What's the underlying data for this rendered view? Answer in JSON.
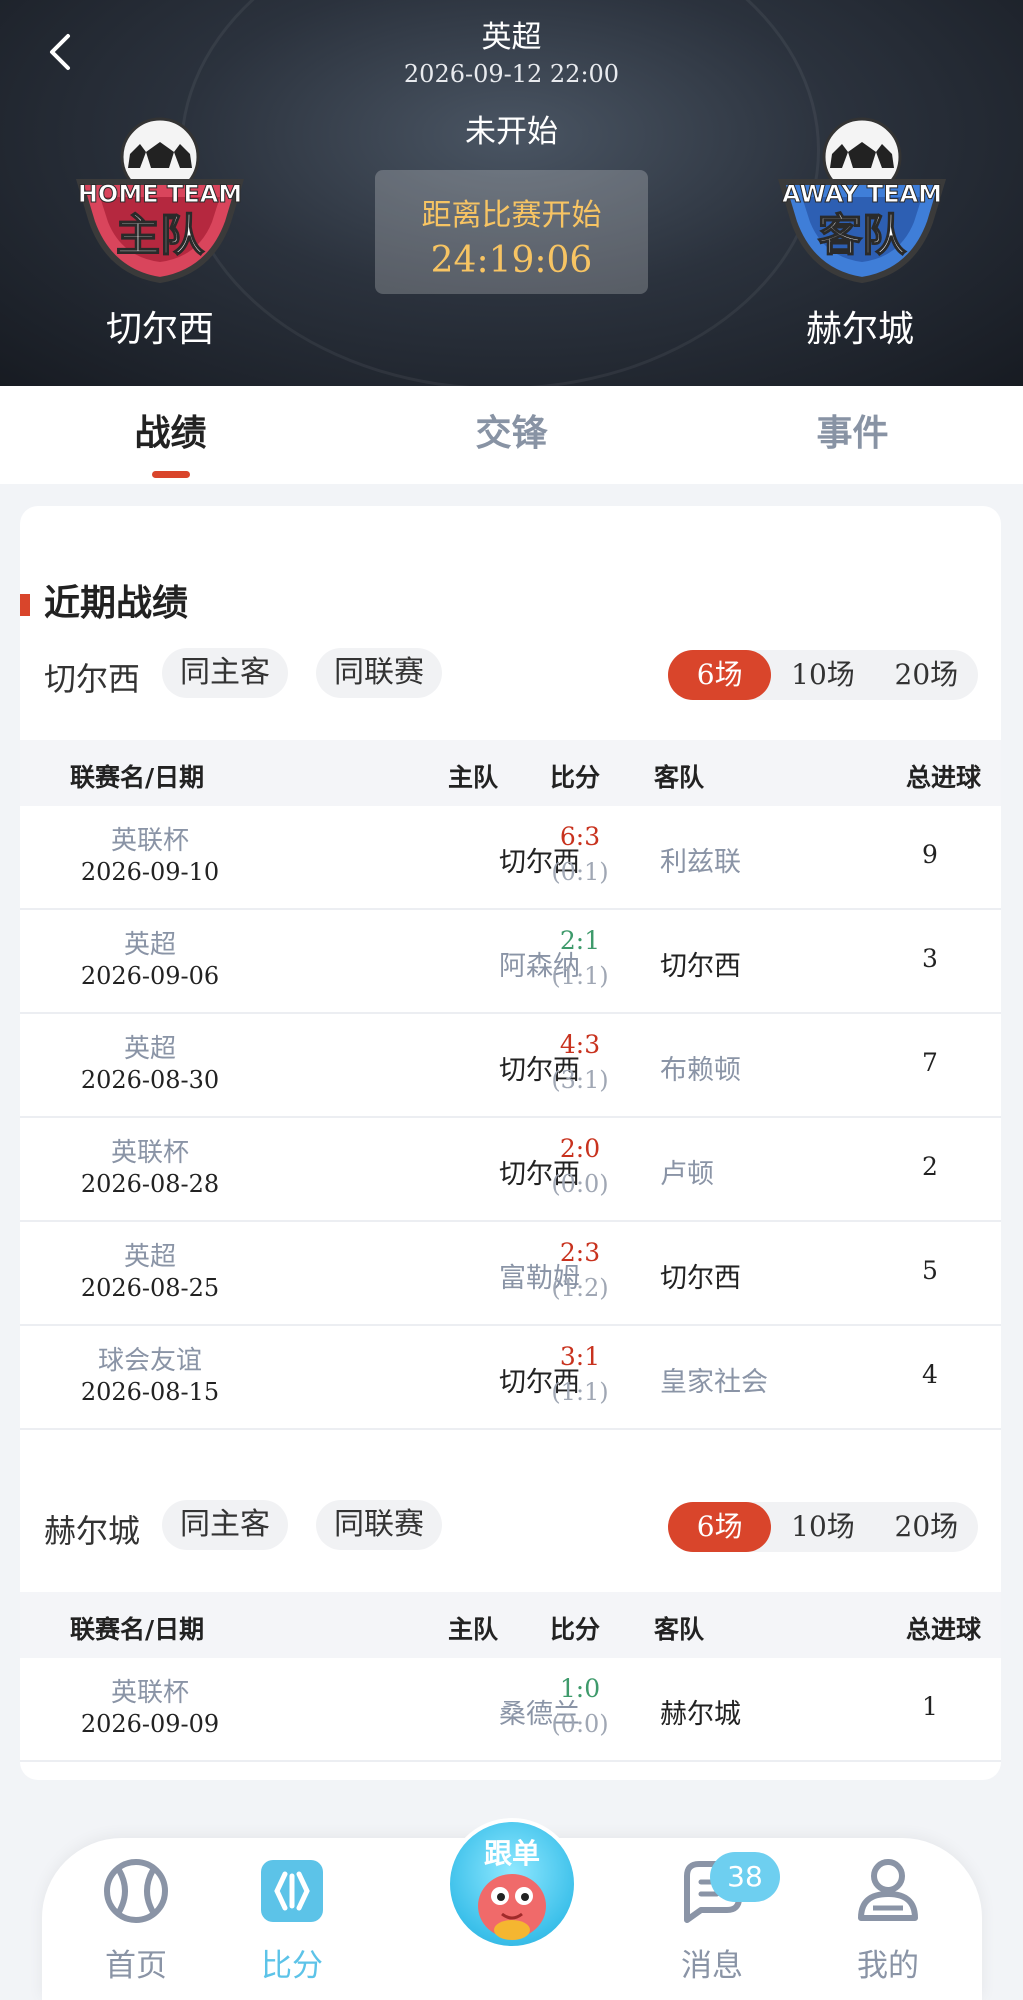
{
  "header": {
    "league": "英超",
    "datetime": "2026-09-12 22:00",
    "status": "未开始",
    "countdown_label": "距离比赛开始",
    "countdown_time": "24:19:06",
    "home_logo_text": "HOME TEAM",
    "home_logo_cn": "主队",
    "away_logo_text": "AWAY TEAM",
    "away_logo_cn": "客队",
    "home_team": "切尔西",
    "away_team": "赫尔城"
  },
  "tabs": [
    {
      "label": "战绩"
    },
    {
      "label": "交锋"
    },
    {
      "label": "事件"
    }
  ],
  "section": {
    "title": "近期战绩",
    "filter_same_venue": "同主客",
    "filter_same_league": "同联赛",
    "counts": [
      "6场",
      "10场",
      "20场"
    ]
  },
  "table_headers": {
    "league_date": "联赛名/日期",
    "home": "主队",
    "score": "比分",
    "away": "客队",
    "total_goals": "总进球"
  },
  "home_team_block": {
    "team": "切尔西",
    "rows": [
      {
        "league": "英联杯",
        "date": "2026-09-10",
        "home": "切尔西",
        "ft": "6:3",
        "ht": "(0:1)",
        "away": "利兹联",
        "goals": "9"
      },
      {
        "league": "英超",
        "date": "2026-09-06",
        "home": "阿森纳",
        "ft": "2:1",
        "ht": "(1:1)",
        "away": "切尔西",
        "goals": "3"
      },
      {
        "league": "英超",
        "date": "2026-08-30",
        "home": "切尔西",
        "ft": "4:3",
        "ht": "(3:1)",
        "away": "布赖顿",
        "goals": "7"
      },
      {
        "league": "英联杯",
        "date": "2026-08-28",
        "home": "切尔西",
        "ft": "2:0",
        "ht": "(0:0)",
        "away": "卢顿",
        "goals": "2"
      },
      {
        "league": "英超",
        "date": "2026-08-25",
        "home": "富勒姆",
        "ft": "2:3",
        "ht": "(1:2)",
        "away": "切尔西",
        "goals": "5"
      },
      {
        "league": "球会友谊",
        "date": "2026-08-15",
        "home": "切尔西",
        "ft": "3:1",
        "ht": "(1:1)",
        "away": "皇家社会",
        "goals": "4"
      }
    ]
  },
  "away_team_block": {
    "team": "赫尔城",
    "rows": [
      {
        "league": "英联杯",
        "date": "2026-09-09",
        "home": "桑德兰",
        "ft": "1:0",
        "ht": "(0:0)",
        "away": "赫尔城",
        "goals": "1"
      }
    ]
  },
  "nav": {
    "home": "首页",
    "score": "比分",
    "center": "跟单",
    "messages": "消息",
    "messages_badge": "38",
    "mine": "我的"
  },
  "colors": {
    "accent": "#d9452b",
    "win_red": "#c8321e",
    "draw_green": "#3e9a6b",
    "nav_active": "#5cc3e8"
  }
}
